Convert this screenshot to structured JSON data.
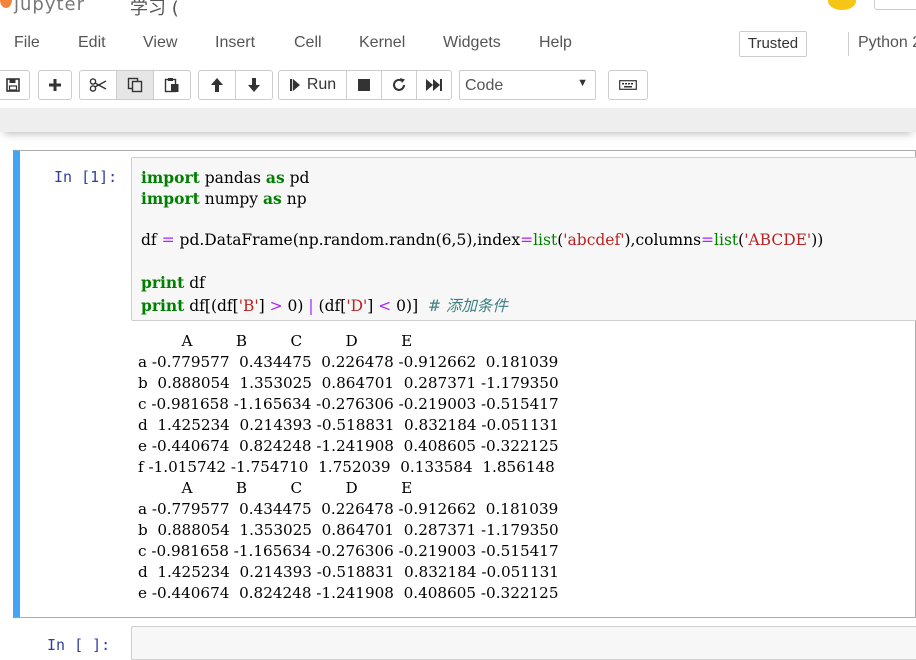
{
  "header": {
    "brand": "jupyter",
    "title_partial": "学习 (",
    "accent": "#f37726"
  },
  "menubar": {
    "items": [
      "File",
      "Edit",
      "View",
      "Insert",
      "Cell",
      "Kernel",
      "Widgets",
      "Help"
    ],
    "trusted_label": "Trusted",
    "kernel_name": "Python 2"
  },
  "toolbar": {
    "buttons": [
      {
        "icon": "save-icon"
      },
      {
        "icon": "plus-icon"
      },
      {
        "icon": "scissors-icon"
      },
      {
        "icon": "copy-icon"
      },
      {
        "icon": "paste-icon"
      },
      {
        "icon": "arrow-up-icon"
      },
      {
        "icon": "arrow-down-icon"
      },
      {
        "icon": "step-forward-icon"
      },
      {
        "icon": "stop-icon"
      },
      {
        "icon": "restart-icon"
      },
      {
        "icon": "fast-forward-icon"
      },
      {
        "icon": "keyboard-icon"
      }
    ],
    "run_label": "Run",
    "cell_type": "Code"
  },
  "cells": [
    {
      "prompt": "In  [1]:",
      "code": [
        "import pandas as pd",
        "import numpy as np",
        "",
        "df = pd.DataFrame(np.random.randn(6,5),index=list('abcdef'),columns=list('ABCDE'))",
        "",
        "print df",
        "print df[(df['B'] > 0) | (df['D'] < 0)]  # 添加条件"
      ],
      "output": [
        "         A         B         C         D         E",
        "a -0.779577  0.434475  0.226478 -0.912662  0.181039",
        "b  0.888054  1.353025  0.864701  0.287371 -1.179350",
        "c -0.981658 -1.165634 -0.276306 -0.219003 -0.515417",
        "d  1.425234  0.214393 -0.518831  0.832184 -0.051131",
        "e -0.440674  0.824248 -1.241908  0.408605 -0.322125",
        "f -1.015742 -1.754710  1.752039  0.133584  1.856148",
        "         A         B         C         D         E",
        "a -0.779577  0.434475  0.226478 -0.912662  0.181039",
        "b  0.888054  1.353025  0.864701  0.287371 -1.179350",
        "c -0.981658 -1.165634 -0.276306 -0.219003 -0.515417",
        "d  1.425234  0.214393 -0.518831  0.832184 -0.051131",
        "e -0.440674  0.824248 -1.241908  0.408605 -0.322125"
      ]
    },
    {
      "prompt": "In  [  ]:",
      "code": []
    }
  ],
  "colors": {
    "selected_cell_border": "#42a5f5",
    "prompt": "#303f9f",
    "keyword": "#008000",
    "string": "#ba2121",
    "operator": "#aa22ff",
    "comment": "#408080"
  }
}
